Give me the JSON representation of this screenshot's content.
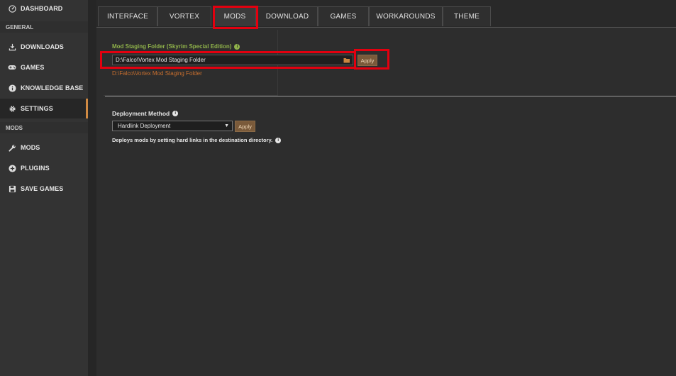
{
  "sidebar": {
    "dashboard": "DASHBOARD",
    "general_header": "GENERAL",
    "downloads": "DOWNLOADS",
    "games": "GAMES",
    "knowledge_base": "KNOWLEDGE BASE",
    "settings": "SETTINGS",
    "mods_header": "MODS",
    "mods": "MODS",
    "plugins": "PLUGINS",
    "save_games": "SAVE GAMES"
  },
  "tabs": [
    "INTERFACE",
    "VORTEX",
    "MODS",
    "DOWNLOAD",
    "GAMES",
    "WORKAROUNDS",
    "THEME"
  ],
  "active_tab": "MODS",
  "staging": {
    "label": "Mod Staging Folder (Skyrim Special Edition)",
    "value": "D:\\Falco\\Vortex Mod Staging Folder",
    "resolved_path": "D:\\Falco\\Vortex Mod Staging Folder",
    "apply_label": "Apply"
  },
  "deployment": {
    "label": "Deployment Method",
    "selected": "Hardlink Deployment",
    "apply_label": "Apply",
    "description": "Deploys mods by setting hard links in the destination directory."
  },
  "colors": {
    "accent": "#d08a43",
    "label_green": "#8fb24a",
    "path_orange": "#c86f2e",
    "highlight_red": "#e3000f"
  }
}
